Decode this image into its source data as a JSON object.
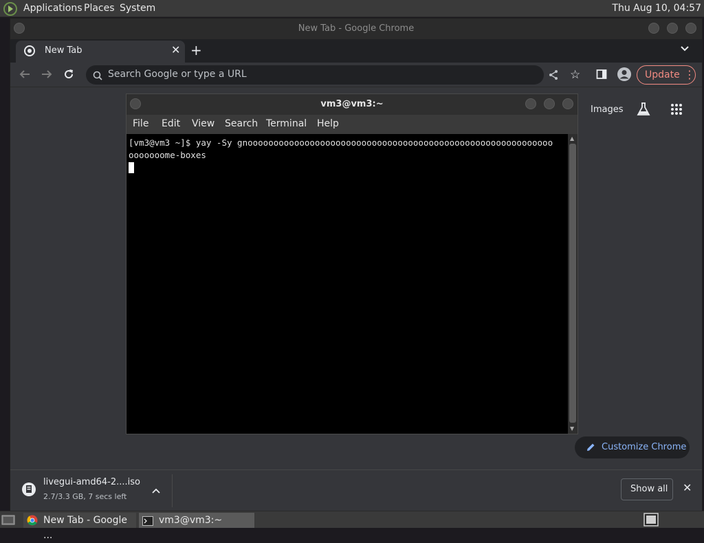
{
  "top_panel": {
    "menus": [
      "Applications",
      "Places",
      "System"
    ],
    "clock": "Thu Aug 10, 04:57"
  },
  "chrome": {
    "window_title": "New Tab - Google Chrome",
    "tab": {
      "label": "New Tab"
    },
    "omnibox": {
      "placeholder": "Search Google or type a URL"
    },
    "update_label": "Update",
    "ntp": {
      "images_link": "Images",
      "customize_label": "Customize Chrome"
    },
    "download": {
      "filename": "livegui-amd64-2....iso",
      "status": "2.7/3.3 GB, 7 secs left",
      "show_all": "Show all"
    }
  },
  "terminal": {
    "title": "vm3@vm3:~",
    "menus": [
      "File",
      "Edit",
      "View",
      "Search",
      "Terminal",
      "Help"
    ],
    "lines": [
      "[vm3@vm3 ~]$ yay -Sy gnooooooooooooooooooooooooooooooooooooooooooooooooooooooooooo",
      "ooooooome-boxes"
    ]
  },
  "taskbar": {
    "items": [
      "New Tab - Google ...",
      "vm3@vm3:~"
    ]
  },
  "colors": {
    "accent_update": "#f28b82",
    "link_blue": "#8ab4f8"
  }
}
